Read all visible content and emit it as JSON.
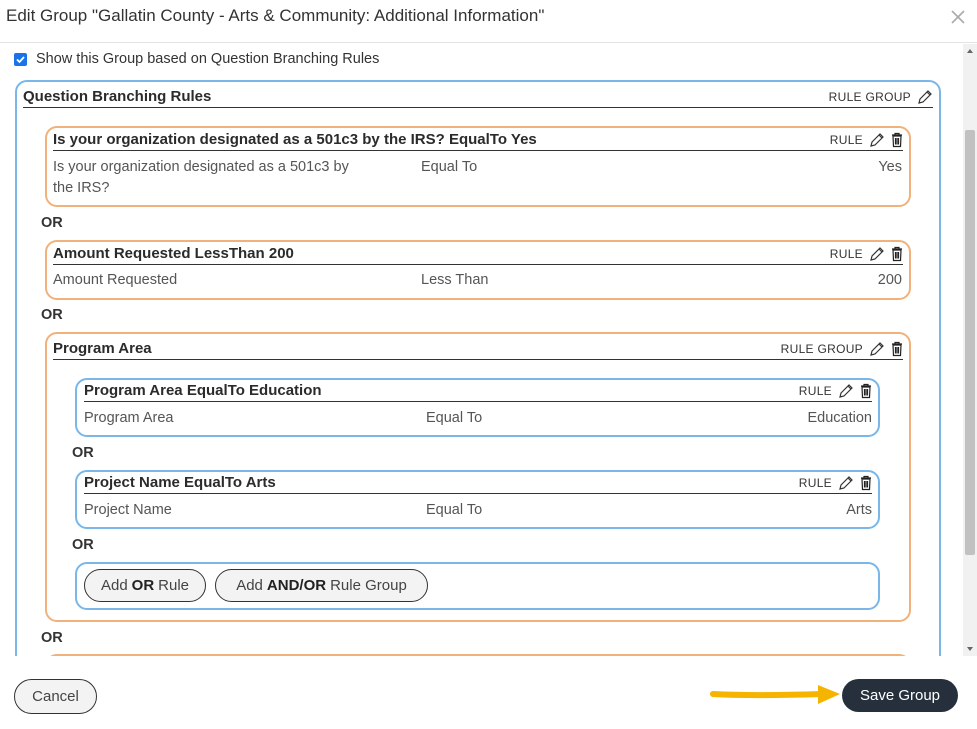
{
  "dialog": {
    "title": "Edit Group \"Gallatin County - Arts & Community: Additional Information\"",
    "close_icon": "close-icon"
  },
  "show_group": {
    "checked": true,
    "label": "Show this Group based on Question Branching Rules"
  },
  "root_group": {
    "title": "Question Branching Rules",
    "tag": "RULE GROUP"
  },
  "or_label": "OR",
  "rules": [
    {
      "title": "Is your organization designated as a 501c3 by the IRS? EqualTo Yes",
      "tag": "RULE",
      "question_line1": "Is your organization designated as a 501c3 by",
      "question_line2": "the IRS?",
      "operator": "Equal To",
      "value": "Yes"
    },
    {
      "title": "Amount Requested LessThan 200",
      "tag": "RULE",
      "question": "Amount Requested",
      "operator": "Less Than",
      "value": "200"
    }
  ],
  "program_group": {
    "title": "Program Area",
    "tag": "RULE GROUP",
    "rules": [
      {
        "title": "Program Area EqualTo Education",
        "tag": "RULE",
        "question": "Program Area",
        "operator": "Equal To",
        "value": "Education"
      },
      {
        "title": "Project Name EqualTo Arts",
        "tag": "RULE",
        "question": "Project Name",
        "operator": "Equal To",
        "value": "Arts"
      }
    ],
    "add_or_rule": {
      "prefix": "Add",
      "bold": "OR",
      "suffix": "Rule"
    },
    "add_group": {
      "prefix": "Add",
      "bold": "AND/OR",
      "suffix": "Rule Group"
    }
  },
  "footer": {
    "cancel_label": "Cancel",
    "save_label": "Save Group"
  },
  "colors": {
    "save_button": "#26303c",
    "checkbox": "#1a73e8",
    "rule_border_blue": "#7ab6e8",
    "group_border_orange": "#f0b27a",
    "annotation_arrow": "#f5b400"
  }
}
